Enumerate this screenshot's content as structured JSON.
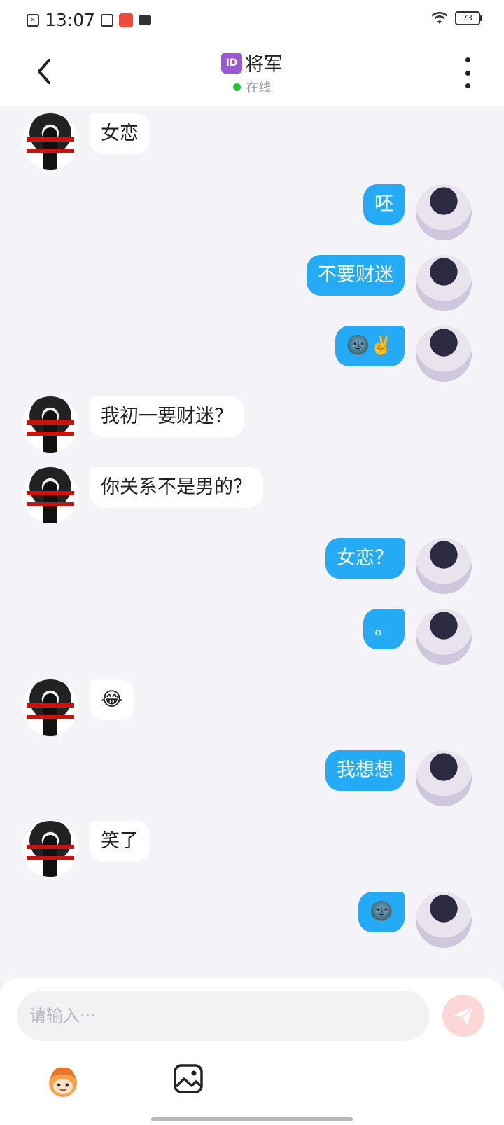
{
  "status_bar": {
    "time": "13:07",
    "battery": "73",
    "icons": [
      "sim-off-icon",
      "screenshot-icon",
      "app-notification-icon",
      "video-icon",
      "wifi-icon",
      "battery-icon"
    ]
  },
  "header": {
    "id_badge": "ID",
    "title": "将军",
    "status": "在线",
    "status_color": "#2bc23a"
  },
  "messages": [
    {
      "side": "left",
      "text": "女恋"
    },
    {
      "side": "right",
      "text": "呸"
    },
    {
      "side": "right",
      "text": "不要财迷"
    },
    {
      "side": "right",
      "text": "🌚✌️"
    },
    {
      "side": "left",
      "text": "我初一要财迷？"
    },
    {
      "side": "left",
      "text": "你关系不是男的？"
    },
    {
      "side": "right",
      "text": "女恋？"
    },
    {
      "side": "right",
      "text": "。"
    },
    {
      "side": "left",
      "text": "😂"
    },
    {
      "side": "right",
      "text": "我想想"
    },
    {
      "side": "left",
      "text": "笑了"
    },
    {
      "side": "right",
      "text": "🌚"
    }
  ],
  "input": {
    "placeholder": "请输入···",
    "value": ""
  },
  "colors": {
    "accent_blue": "#25aaf5",
    "send_button": "#fbd7d7"
  }
}
